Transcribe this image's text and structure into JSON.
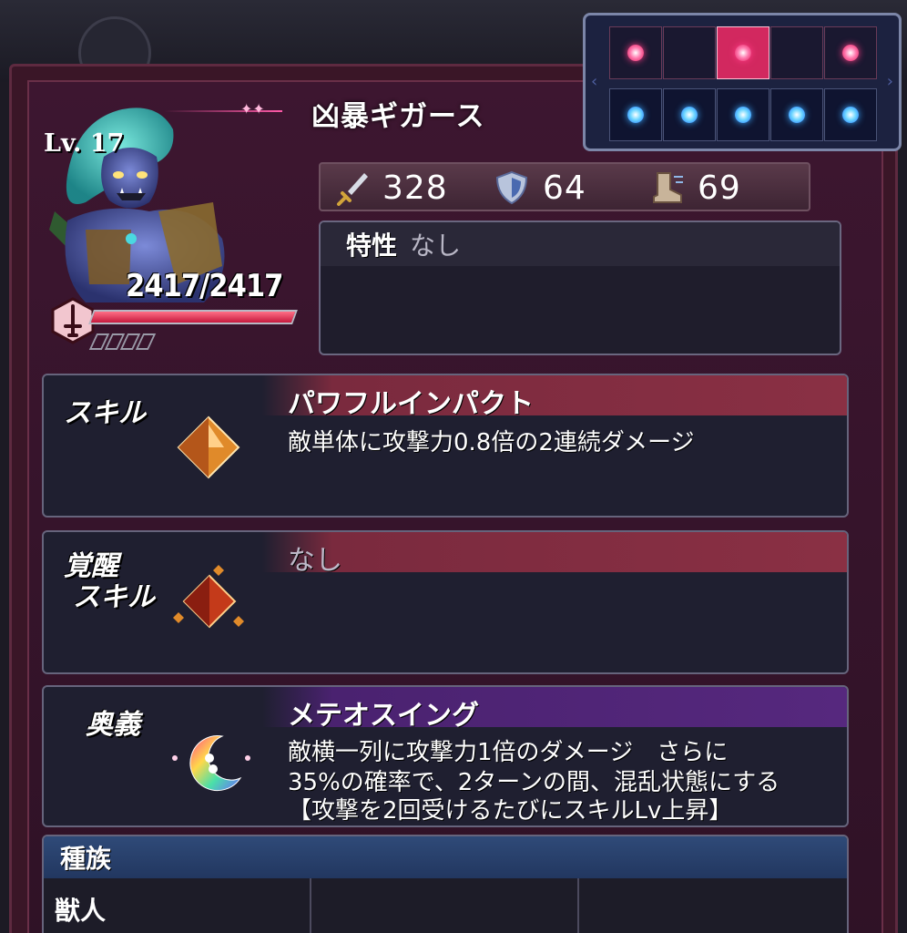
{
  "unit": {
    "name": "凶暴ギガース",
    "level": "Lv. 17",
    "hp": "2417/2417",
    "hp_fraction": 1.0
  },
  "stats": {
    "attack": "328",
    "defense": "64",
    "speed": "69"
  },
  "trait": {
    "label": "特性",
    "value": "なし"
  },
  "formation": {
    "front_row": [
      true,
      false,
      true,
      false,
      true
    ],
    "front_row_highlight": [
      false,
      false,
      true,
      false,
      false
    ],
    "back_row": [
      true,
      true,
      true,
      true,
      true
    ]
  },
  "skill": {
    "label": "スキル",
    "title": "パワフルインパクト",
    "description": "敵単体に攻撃力0.8倍の2連続ダメージ"
  },
  "awakened_skill": {
    "label_line1": "覚醒",
    "label_line2": "スキル",
    "title": "なし"
  },
  "ougi": {
    "label": "奥義",
    "title": "メテオスイング",
    "description_line1": "敵横一列に攻撃力1倍のダメージ　さらに",
    "description_line2": "35%の確率で、2ターンの間、混乱状態にする",
    "description_line3": "【攻撃を2回受けるたびにスキルLv上昇】"
  },
  "species": {
    "header": "種族",
    "values": [
      "獣人",
      "",
      ""
    ]
  },
  "colors": {
    "frame": "#3a1627",
    "skill_band": "#7a2a3e",
    "ougi_band": "#4a2270",
    "species_band": "#2f4a78",
    "formation_active": "#d2285f"
  }
}
